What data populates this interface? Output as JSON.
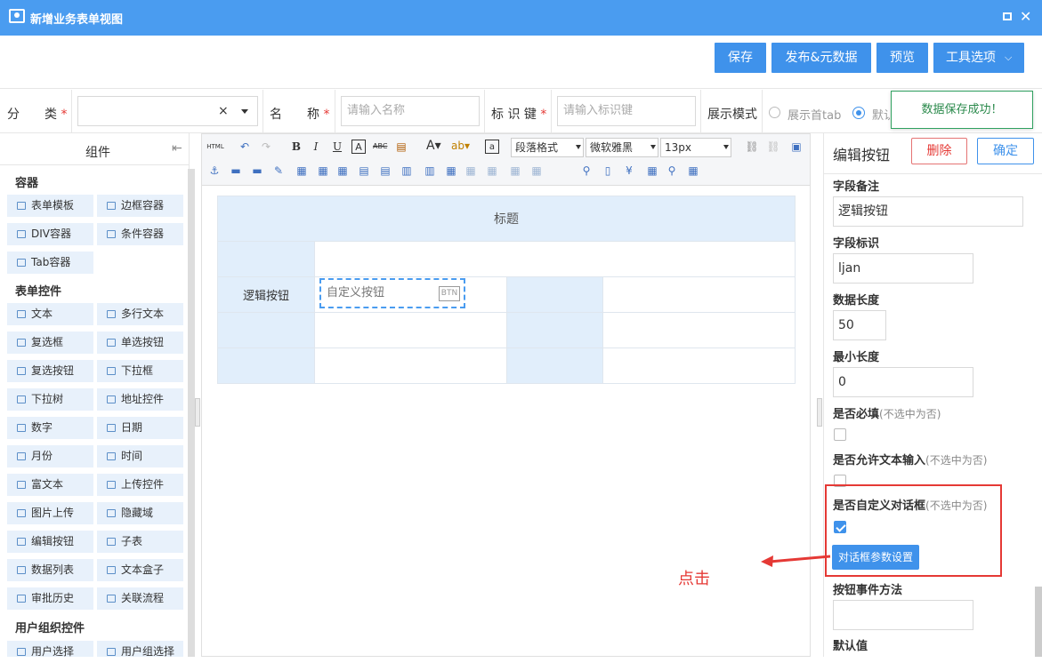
{
  "window": {
    "title": "新增业务表单视图"
  },
  "topbar": {
    "save": "保存",
    "publish": "发布&元数据",
    "preview": "预览",
    "tools": "工具选项"
  },
  "form": {
    "category_label": "分　　类",
    "category_value": "",
    "clear": "×",
    "name_label": "名　　称",
    "name_placeholder": "请输入名称",
    "key_label": "标 识 键",
    "key_placeholder": "请输入标识键",
    "required_mark": "*",
    "display_label": "展示模式",
    "display_opt1": "展示首tab",
    "display_opt2": "默认",
    "toast": "数据保存成功！"
  },
  "components": {
    "title": "组件",
    "sections": [
      "容器",
      "表单控件",
      "用户组织控件"
    ],
    "container_items": [
      "表单模板",
      "边框容器",
      "DIV容器",
      "条件容器",
      "Tab容器"
    ],
    "form_items": [
      "文本",
      "多行文本",
      "复选框",
      "单选按钮",
      "复选按钮",
      "下拉框",
      "下拉树",
      "地址控件",
      "数字",
      "日期",
      "月份",
      "时间",
      "富文本",
      "上传控件",
      "图片上传",
      "隐藏域",
      "编辑按钮",
      "子表",
      "数据列表",
      "文本盒子",
      "审批历史",
      "关联流程"
    ],
    "user_items": [
      "用户选择",
      "用户组选择"
    ]
  },
  "editor": {
    "toolbar": {
      "html": "HTML",
      "bold": "B",
      "italic": "I",
      "underline": "U",
      "para": "段落格式",
      "font": "微软雅黑",
      "size": "13px"
    },
    "table": {
      "title": "标题",
      "row_label": "逻辑按钮",
      "button_text": "自定义按钮",
      "button_tag": "BTN"
    }
  },
  "props": {
    "title": "编辑按钮",
    "delete": "删除",
    "confirm": "确定",
    "remark_label": "字段备注",
    "remark_value": "逻辑按钮",
    "key_label": "字段标识",
    "key_value": "ljan",
    "len_label": "数据长度",
    "len_value": "50",
    "minlen_label": "最小长度",
    "minlen_value": "0",
    "required_label": "是否必填",
    "hint": "(不选中为否)",
    "allow_text_label": "是否允许文本输入",
    "custom_dialog_label": "是否自定义对话框",
    "dialog_btn": "对话框参数设置",
    "event_label": "按钮事件方法",
    "default_label": "默认值"
  },
  "annotation": {
    "click": "点击"
  },
  "colors": {
    "primary": "#3f92eb",
    "titlebar": "#4a9cf0",
    "highlight": "#e53935",
    "success": "#2b8a4c"
  }
}
